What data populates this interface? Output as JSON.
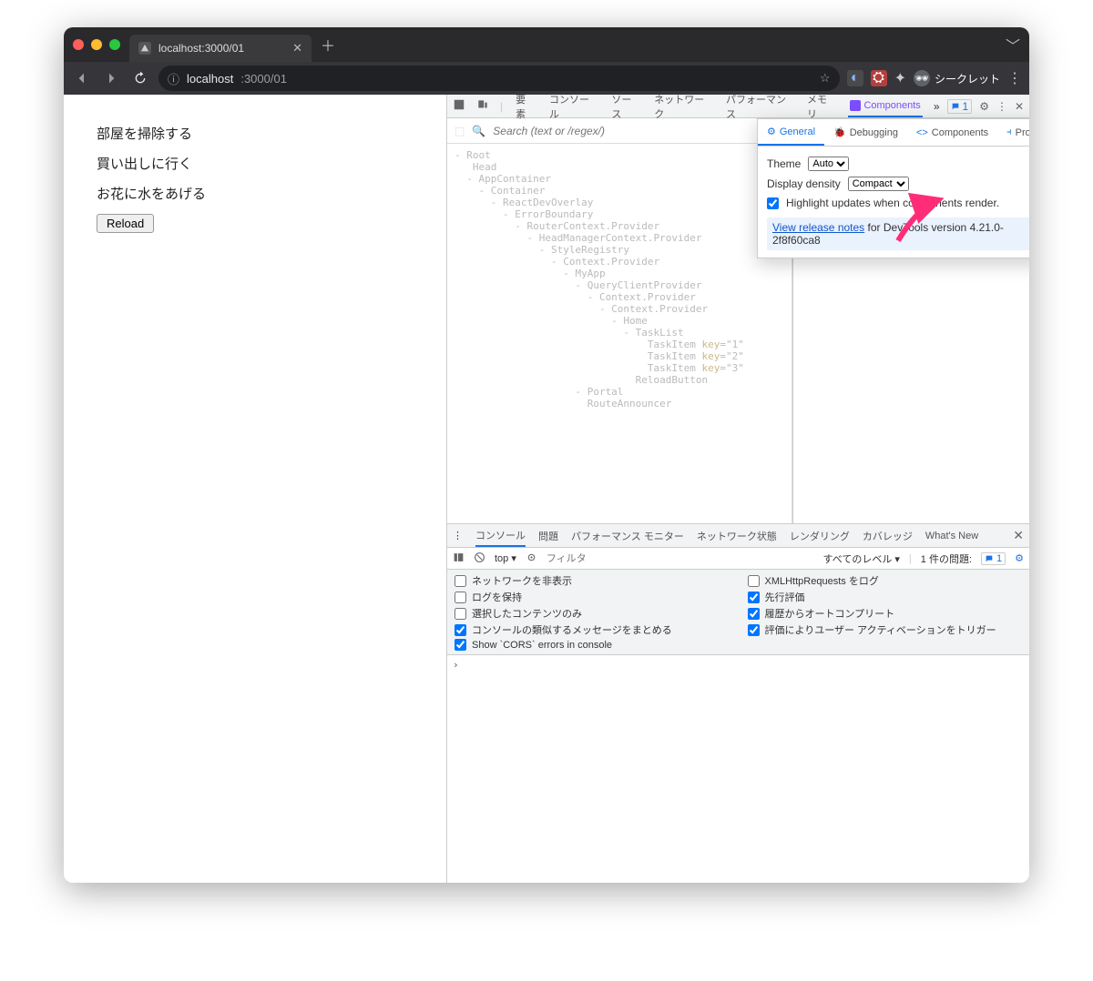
{
  "browser": {
    "tab_title": "localhost:3000/01",
    "url_host": "localhost",
    "url_path": ":3000/01",
    "incognito_label": "シークレット"
  },
  "page": {
    "tasks": [
      "部屋を掃除する",
      "買い出しに行く",
      "お花に水をあげる"
    ],
    "reload": "Reload"
  },
  "devtools": {
    "tabs": [
      "要素",
      "コンソール",
      "ソース",
      "ネットワーク",
      "パフォーマンス",
      "メモリ"
    ],
    "components_tab": "Components",
    "issues_count": "1",
    "search_placeholder": "Search (text or /regex/)"
  },
  "tree": [
    "- Root",
    "   Head",
    "  - AppContainer",
    "    - Container",
    "      - ReactDevOverlay",
    "        - ErrorBoundary",
    "          - RouterContext.Provider",
    "            - HeadManagerContext.Provider",
    "              - StyleRegistry",
    "                - Context.Provider",
    "                  - MyApp",
    "                    - QueryClientProvider",
    "                      - Context.Provider",
    "                        - Context.Provider",
    "                          - Home",
    "                            - TaskList",
    "                                TaskItem key=\"1\"",
    "                                TaskItem key=\"2\"",
    "                                TaskItem key=\"3\"",
    "                              ReloadButton",
    "                    - Portal",
    "                      RouteAnnouncer"
  ],
  "settings": {
    "tabs": {
      "general": "General",
      "debugging": "Debugging",
      "components": "Components",
      "profiler": "Profiler"
    },
    "theme_label": "Theme",
    "theme_value": "Auto",
    "density_label": "Display density",
    "density_value": "Compact",
    "highlight_label": "Highlight updates when components render.",
    "release_link": "View release notes",
    "release_text": " for DevTools version 4.21.0-2f8f60ca8"
  },
  "drawer": {
    "tabs": [
      "コンソール",
      "問題",
      "パフォーマンス モニター",
      "ネットワーク状態",
      "レンダリング",
      "カバレッジ",
      "What's New"
    ],
    "context": "top ▾",
    "filter_placeholder": "フィルタ",
    "level": "すべてのレベル ▾",
    "issues_label": "1 件の問題:",
    "issues_count": "1",
    "options": {
      "left": [
        "ネットワークを非表示",
        "ログを保持",
        "選択したコンテンツのみ",
        "コンソールの類似するメッセージをまとめる",
        "Show `CORS` errors in console"
      ],
      "right": [
        "XMLHttpRequests をログ",
        "先行評価",
        "履歴からオートコンプリート",
        "評価によりユーザー アクティベーションをトリガー"
      ]
    },
    "checked_left": [
      false,
      false,
      false,
      true,
      true
    ],
    "checked_right": [
      false,
      true,
      true,
      true
    ],
    "prompt": "›"
  }
}
